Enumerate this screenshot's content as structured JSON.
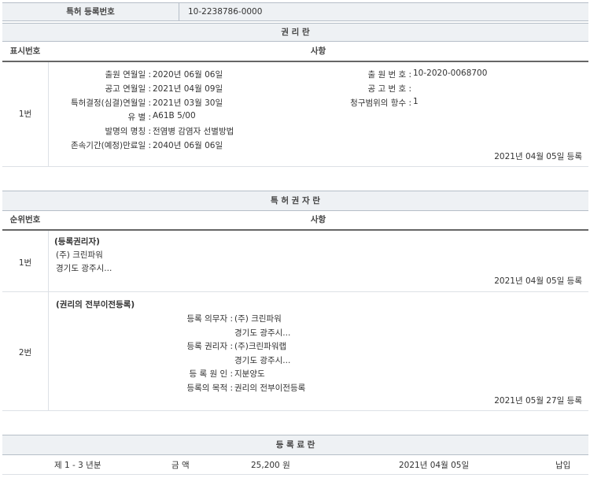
{
  "reg_number": {
    "label": "특허 등록번호",
    "value": "10-2238786-0000"
  },
  "rights": {
    "title": "권 리 란",
    "col_num": "표시번호",
    "col_item": "사항",
    "row_num": "1번",
    "left_fields": [
      {
        "label": "출원 연월일 :",
        "value": "2020년 06월 06일"
      },
      {
        "label": "공고 연월일 :",
        "value": "2021년 04월 09일"
      },
      {
        "label": "특허결정(심결)연월일 :",
        "value": "2021년 03월 30일"
      },
      {
        "label": "유 별 :",
        "value": "A61B 5/00"
      },
      {
        "label": "발명의 명칭 :",
        "value": "전염병 감염자 선별방법"
      },
      {
        "label": "존속기간(예정)만료일 :",
        "value": "2040년 06월 06일"
      }
    ],
    "right_fields": [
      {
        "label": "출 원 번 호 :",
        "value": "10-2020-0068700"
      },
      {
        "label": "공 고 번 호 :",
        "value": ""
      },
      {
        "label": "청구범위의 항수 :",
        "value": "1"
      }
    ],
    "reg_date": "2021년 04월 05일 등록"
  },
  "holders": {
    "title": "특 허 권 자 란",
    "col_num": "순위번호",
    "col_item": "사항",
    "row1": {
      "num": "1번",
      "heading": "(등록권리자)",
      "name": "(주) 크린파워",
      "address": "경기도 광주시...",
      "reg_date": "2021년 04월 05일 등록"
    },
    "row2": {
      "num": "2번",
      "heading": "(권리의 전부이전등록)",
      "fields": [
        {
          "label": "등록 의무자 :",
          "value": "(주) 크린파워"
        },
        {
          "label": "",
          "value": "경기도 광주시..."
        },
        {
          "label": "등록 권리자 :",
          "value": "(주)크린파워랩"
        },
        {
          "label": "",
          "value": "경기도 광주시..."
        },
        {
          "label": "등 록 원 인 :",
          "value": "지분양도"
        },
        {
          "label": "등록의 목적 :",
          "value": "권리의 전부이전등록"
        }
      ],
      "reg_date": "2021년 05월 27일 등록"
    }
  },
  "fee": {
    "title": "등 록 료 란",
    "period": "제 1 - 3 년분",
    "amount_label": "금 액",
    "amount": "25,200 원",
    "date": "2021년 04월 05일",
    "status": "납입"
  }
}
